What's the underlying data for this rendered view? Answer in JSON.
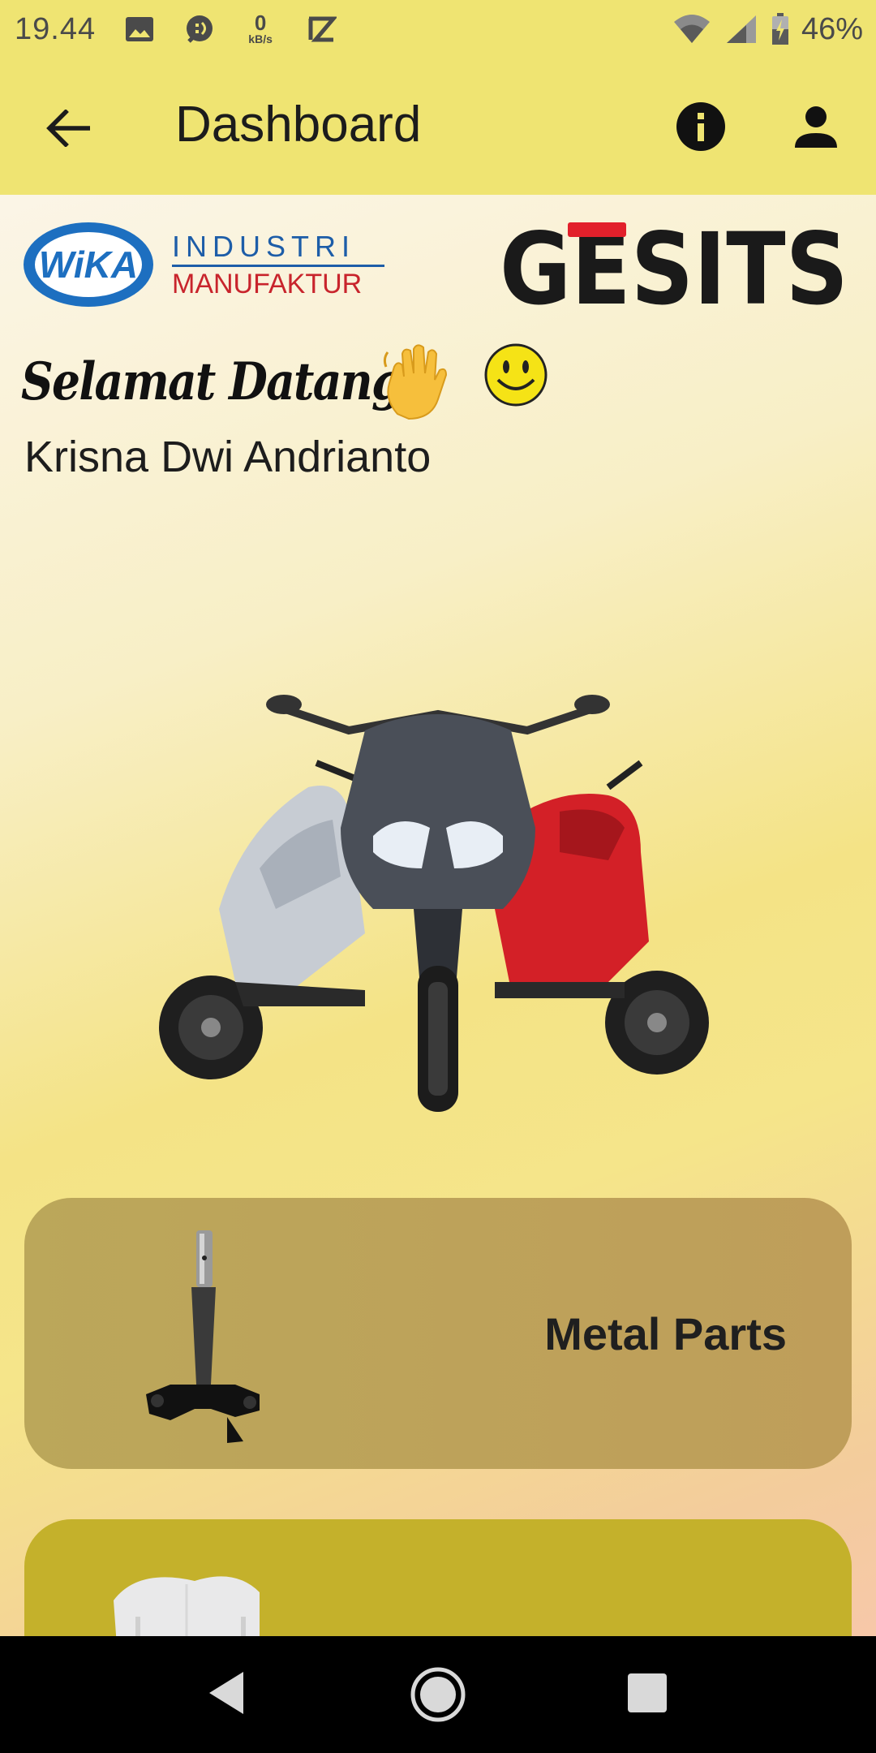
{
  "status_bar": {
    "time": "19.44",
    "net_speed_value": "0",
    "net_speed_unit": "kB/s",
    "battery": "46%",
    "icons": [
      "image-icon",
      "chat-icon",
      "net-speed-icon",
      "app-z-icon",
      "wifi-icon",
      "signal-icon",
      "battery-icon"
    ]
  },
  "app_bar": {
    "title": "Dashboard",
    "back_icon": "arrow-back-icon",
    "info_icon": "info-icon",
    "account_icon": "account-icon",
    "background": "#efe472"
  },
  "logos": {
    "wika_mark": "WiKA",
    "wika_line1": "INDUSTRI",
    "wika_line2": "MANUFAKTUR",
    "gesits": "GESITS"
  },
  "greeting": {
    "welcome": "Selamat Datang,",
    "user_name": "Krisna Dwi Andrianto"
  },
  "categories": [
    {
      "label": "Metal Parts",
      "color": "#bba75a"
    },
    {
      "label": "",
      "color": "#c4b12b"
    }
  ],
  "nav_bar": {
    "icons": [
      "nav-back-icon",
      "nav-home-icon",
      "nav-recents-icon"
    ]
  }
}
